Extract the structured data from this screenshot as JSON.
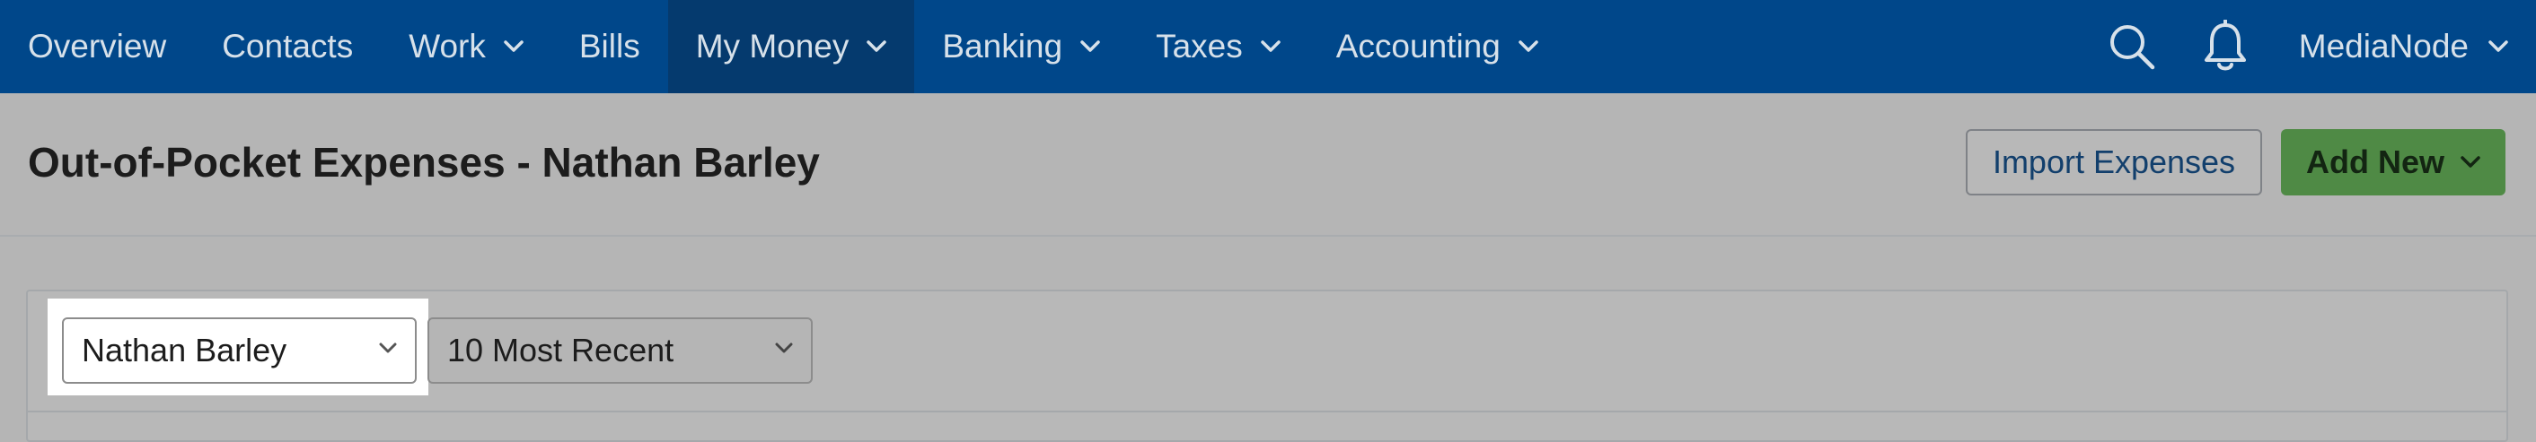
{
  "nav": {
    "items": [
      {
        "label": "Overview",
        "has_dropdown": false,
        "active": false
      },
      {
        "label": "Contacts",
        "has_dropdown": false,
        "active": false
      },
      {
        "label": "Work",
        "has_dropdown": true,
        "active": false
      },
      {
        "label": "Bills",
        "has_dropdown": false,
        "active": false
      },
      {
        "label": "My Money",
        "has_dropdown": true,
        "active": true
      },
      {
        "label": "Banking",
        "has_dropdown": true,
        "active": false
      },
      {
        "label": "Taxes",
        "has_dropdown": true,
        "active": false
      },
      {
        "label": "Accounting",
        "has_dropdown": true,
        "active": false
      }
    ],
    "search_icon": "search-icon",
    "notifications_icon": "bell-icon",
    "account_label": "MediaNode"
  },
  "header": {
    "title": "Out-of-Pocket Expenses - Nathan Barley",
    "import_button": "Import Expenses",
    "add_button": "Add New"
  },
  "filters": {
    "employee_selected": "Nathan Barley",
    "range_selected": "10 Most Recent"
  },
  "colors": {
    "nav_bg": "#00478a",
    "nav_active_bg": "#053a6e",
    "add_button_bg": "#4f8a45",
    "overlay_bg": "#b5b5b5"
  }
}
